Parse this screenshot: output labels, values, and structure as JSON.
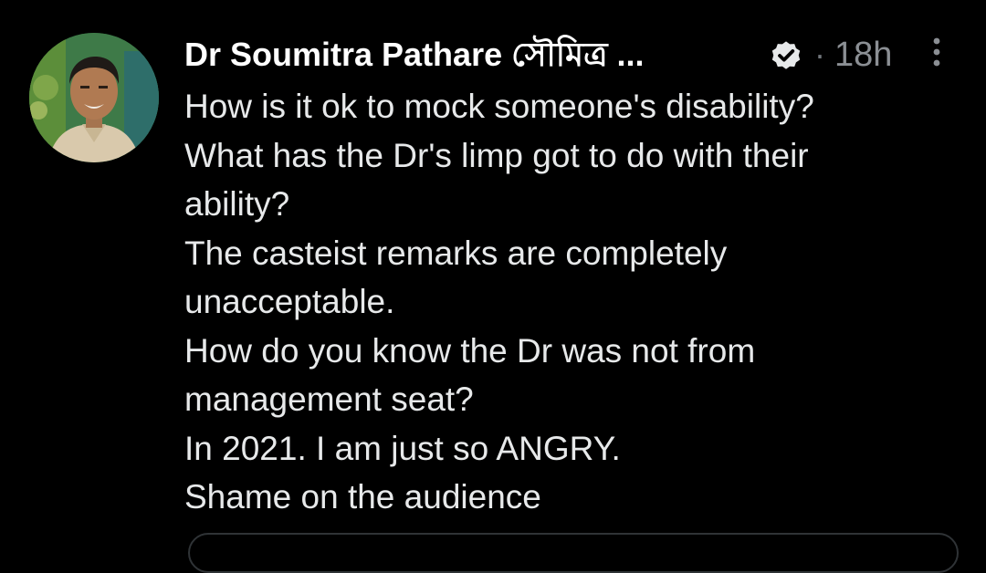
{
  "author": {
    "display_name": "Dr Soumitra Pathare সৌমিত্র ...",
    "verified": true,
    "avatar_icon": "profile-photo"
  },
  "meta": {
    "separator": "·",
    "timestamp": "18h",
    "more_icon": "vertical-ellipsis-icon"
  },
  "tweet": {
    "lines": [
      "How is it ok to mock someone's disability?",
      "What has the Dr's limp got to do with their",
      "ability?",
      "The casteist remarks are completely",
      "unacceptable.",
      "How do you know the Dr was not from",
      "management seat?",
      "In 2021. I am just so ANGRY.",
      "Shame on the audience"
    ]
  },
  "colors": {
    "background": "#000000",
    "text": "#e7e9ea",
    "secondary_text": "#8b8f94",
    "border": "#2f3336"
  }
}
